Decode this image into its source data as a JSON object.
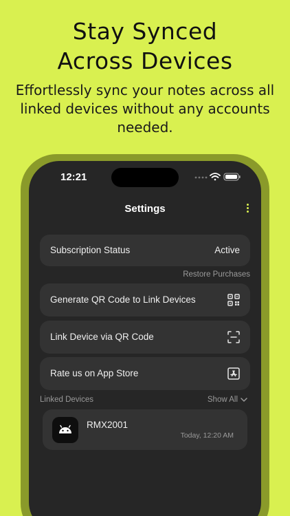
{
  "promo": {
    "headline_line1": "Stay Synced",
    "headline_line2": "Across Devices",
    "subline": "Effortlessly sync your notes across all linked devices without any accounts needed."
  },
  "status_bar": {
    "time": "12:21",
    "icons": [
      "signal-dots-icon",
      "wifi-icon",
      "battery-icon"
    ]
  },
  "nav": {
    "title": "Settings",
    "menu_icon": "kebab-menu-icon"
  },
  "subscription": {
    "label": "Subscription Status",
    "value": "Active",
    "restore_label": "Restore Purchases"
  },
  "settings_items": [
    {
      "label": "Generate QR Code to Link Devices",
      "icon": "qr-code-icon"
    },
    {
      "label": "Link Device via QR Code",
      "icon": "scan-frame-icon"
    },
    {
      "label": "Rate us on App Store",
      "icon": "app-store-icon"
    }
  ],
  "linked_devices": {
    "section_label": "Linked Devices",
    "show_all_label": "Show All",
    "devices": [
      {
        "name": "RMX2001",
        "last_sync": "Today, 12:20 AM",
        "icon": "android-icon"
      }
    ]
  },
  "colors": {
    "background": "#d9f050",
    "accent": "#d9f050",
    "screen": "#262626",
    "card": "#333333"
  }
}
